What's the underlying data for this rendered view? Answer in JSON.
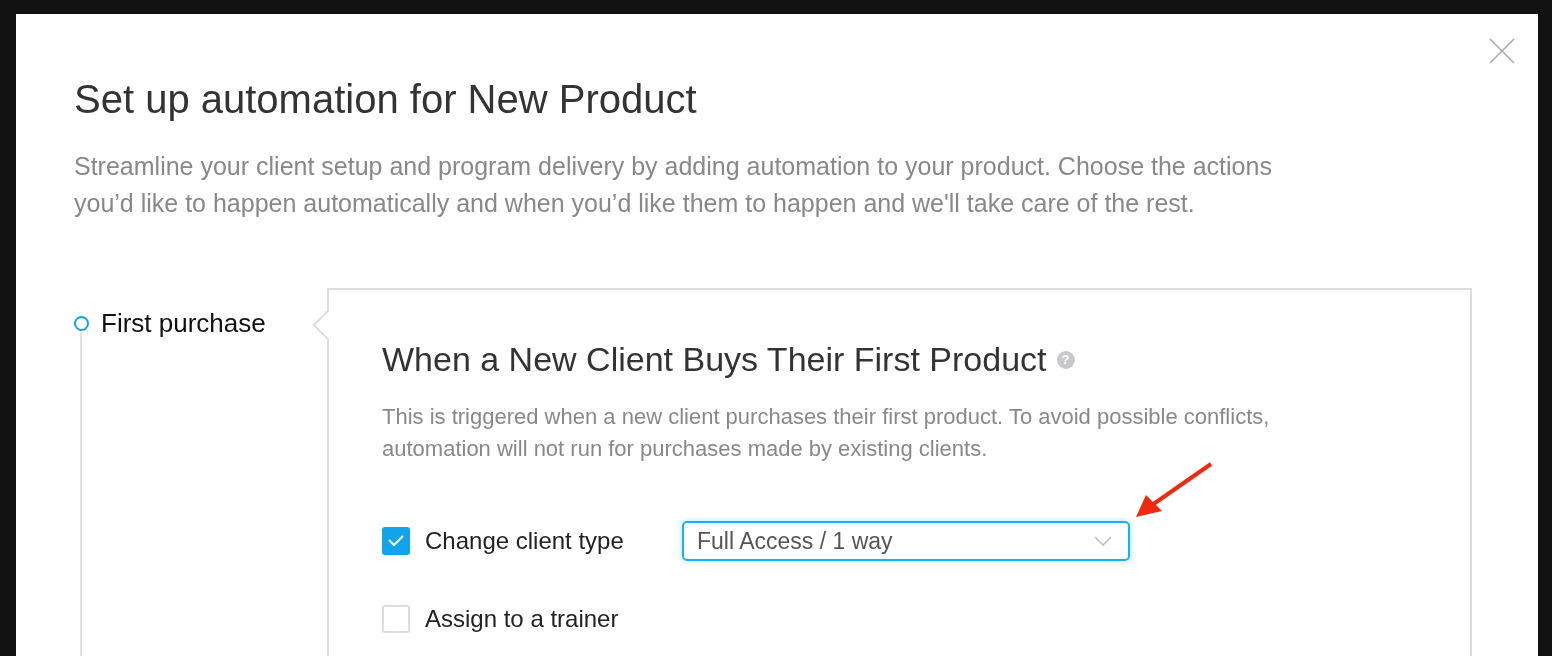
{
  "modal": {
    "title": "Set up automation for New Product",
    "description": "Streamline your client setup and program delivery by adding automation to your product. Choose the actions you’d like to happen automatically and when you’d like them to happen and we'll take care of the rest."
  },
  "steps": [
    {
      "label": "First purchase",
      "selected": true
    }
  ],
  "panel": {
    "title": "When a New Client Buys Their First Product",
    "help": "?",
    "description": "This is triggered when a new client purchases their first product. To avoid possible conflicts, automation will not run for purchases made by existing clients.",
    "actions": [
      {
        "kind": "select",
        "label": "Change client type",
        "checked": true,
        "value": "Full Access / 1 way",
        "focused": true
      },
      {
        "kind": "plain",
        "label": "Assign to a trainer",
        "checked": false
      }
    ]
  }
}
